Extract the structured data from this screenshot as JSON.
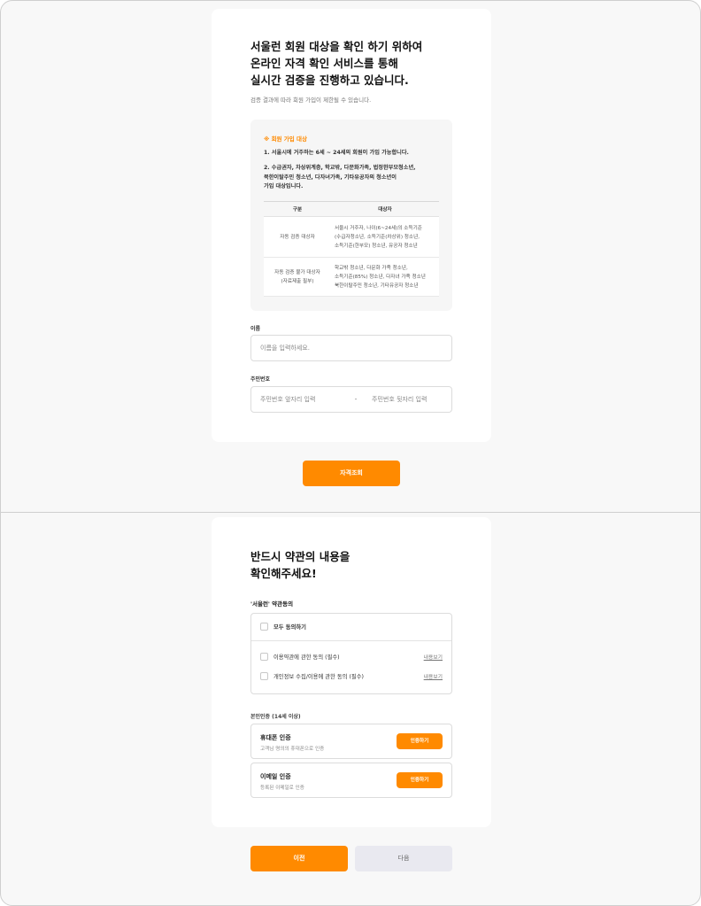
{
  "colors": {
    "accent": "#ff8a00",
    "disabled": "#e9e9f0"
  },
  "eligibility": {
    "heading_lines": [
      "서울런 회원 대상을 확인 하기 위하여",
      "온라인 자격 확인 서비스를 통해",
      "실시간 검증을 진행하고 있습니다."
    ],
    "subtitle": "검증 결과에 따라 회원 가입이 제한될 수 있습니다.",
    "info": {
      "title": "※ 회원 가입 대상",
      "item1": "1. 서울시에 거주하는 6세 ~ 24세의 회원이 가입 가능합니다.",
      "item2_lines": [
        "2. 수급권자, 차상위계층, 학교밖, 다문화가족, 법정한부모청소년,",
        "북한이탈주민 청소년, 다자녀가족, 기타유공자의 청소년이",
        "가입 대상입니다."
      ],
      "table": {
        "headers": [
          "구분",
          "대상자"
        ],
        "rows": [
          {
            "category_lines": [
              "자동 검증 대상자"
            ],
            "target_lines": [
              "서울시 거주자, 나이(6~24세)의 소득기준",
              "(수급자청소년, 소득기준(차상위) 청소년,",
              "소득기준(한부모) 청소년, 유공자 청소년"
            ]
          },
          {
            "category_lines": [
              "자동 검증 불가 대상자",
              "(자료제출 필부)"
            ],
            "target_lines": [
              "학교밖 청소년, 다문화 가족 청소년,",
              "소득기준(85%) 청소년, 다자녀 가족 청소년",
              "북한이탈주민 청소년, 기타유공자 청소년"
            ]
          }
        ]
      }
    },
    "name_label": "이름",
    "name_placeholder": "이름을 입력하세요.",
    "rrn_label": "주민번호",
    "rrn_front_placeholder": "주민번호 앞자리 입력",
    "rrn_dash": "-",
    "rrn_back_placeholder": "주민번호 뒷자리 입력",
    "check_button": "자격조회"
  },
  "terms": {
    "heading_lines": [
      "반드시 약관의 내용을",
      "확인해주세요!"
    ],
    "agree_title": "'서울런' 약관동의",
    "agree_all": "모두 동의하기",
    "items": [
      {
        "label": "이용약관에 관한 동의 (필수)",
        "view": "내용보기"
      },
      {
        "label": "개인정보 수집/이용에 관한 동의 (필수)",
        "view": "내용보기"
      }
    ],
    "auth_title": "본인인증 (14세 이상)",
    "auth_methods": [
      {
        "name": "휴대폰 인증",
        "desc": "고객님 명의의 휴대폰으로 인증",
        "button": "인증하기"
      },
      {
        "name": "이메일 인증",
        "desc": "등록된 이메일로 인증",
        "button": "인증하기"
      }
    ],
    "prev_button": "이전",
    "next_button": "다음"
  }
}
